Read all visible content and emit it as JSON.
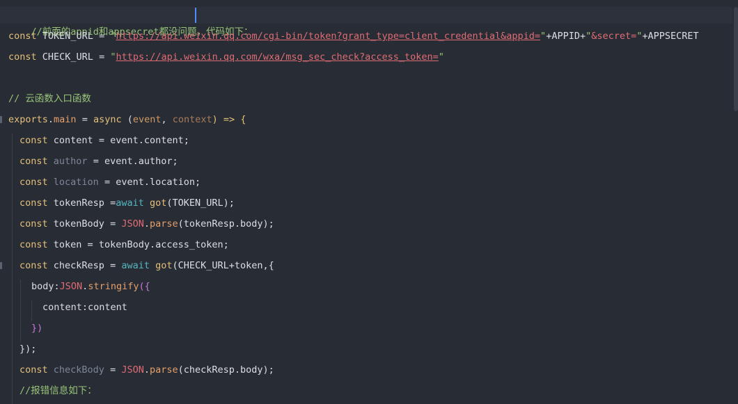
{
  "editor": {
    "lines": [
      {
        "indent": 0,
        "tokens": [
          {
            "t": "//前面的appid和appsecret都没问题，代码如下：",
            "c": "comment"
          }
        ]
      },
      {
        "indent": 0,
        "tokens": [
          {
            "t": "const ",
            "c": "kw2"
          },
          {
            "t": "TOKEN_URL",
            "c": "plain"
          },
          {
            "t": " = ",
            "c": "plain"
          },
          {
            "t": "\"",
            "c": "quote"
          },
          {
            "t": "https://api.weixin.qq.com/cgi-bin/token?grant_type=client_credential&appid=",
            "c": "str"
          },
          {
            "t": "\"",
            "c": "quote"
          },
          {
            "t": "+APPID+",
            "c": "plain"
          },
          {
            "t": "\"",
            "c": "quote"
          },
          {
            "t": "&secret=",
            "c": "str2"
          },
          {
            "t": "\"",
            "c": "quote"
          },
          {
            "t": "+APPSECRET",
            "c": "plain"
          }
        ]
      },
      {
        "indent": 0,
        "tokens": [
          {
            "t": "const ",
            "c": "kw2"
          },
          {
            "t": "CHECK_URL",
            "c": "plain"
          },
          {
            "t": " = ",
            "c": "plain"
          },
          {
            "t": "\"",
            "c": "quote"
          },
          {
            "t": "https://api.weixin.qq.com/wxa/msg_sec_check?access_token=",
            "c": "str"
          },
          {
            "t": "\"",
            "c": "quote"
          }
        ]
      },
      {
        "indent": 0,
        "tokens": []
      },
      {
        "indent": 0,
        "tokens": [
          {
            "t": "// 云函数入口函数",
            "c": "comment"
          }
        ]
      },
      {
        "indent": 0,
        "tokens": [
          {
            "t": "exports",
            "c": "obj"
          },
          {
            "t": ".",
            "c": "plain"
          },
          {
            "t": "main",
            "c": "orange"
          },
          {
            "t": " = ",
            "c": "plain"
          },
          {
            "t": "async",
            "c": "kw2"
          },
          {
            "t": " (",
            "c": "plain"
          },
          {
            "t": "event",
            "c": "param"
          },
          {
            "t": ", ",
            "c": "plain"
          },
          {
            "t": "context",
            "c": "paramdim"
          },
          {
            "t": ") => ",
            "c": "kw2"
          },
          {
            "t": "{",
            "c": "brace"
          }
        ]
      },
      {
        "indent": 1,
        "tokens": [
          {
            "t": "const ",
            "c": "kw2"
          },
          {
            "t": "content",
            "c": "plain"
          },
          {
            "t": " = ",
            "c": "plain"
          },
          {
            "t": "event.content;",
            "c": "plain"
          }
        ]
      },
      {
        "indent": 1,
        "tokens": [
          {
            "t": "const ",
            "c": "kw2"
          },
          {
            "t": "author",
            "c": "dim"
          },
          {
            "t": " = ",
            "c": "plain"
          },
          {
            "t": "event.author;",
            "c": "plain"
          }
        ]
      },
      {
        "indent": 1,
        "tokens": [
          {
            "t": "const ",
            "c": "kw2"
          },
          {
            "t": "location",
            "c": "dim"
          },
          {
            "t": " = ",
            "c": "plain"
          },
          {
            "t": "event.location;",
            "c": "plain"
          }
        ]
      },
      {
        "indent": 1,
        "tokens": [
          {
            "t": "const ",
            "c": "kw2"
          },
          {
            "t": "tokenResp",
            "c": "plain"
          },
          {
            "t": " =",
            "c": "plain"
          },
          {
            "t": "await",
            "c": "await"
          },
          {
            "t": " ",
            "c": "plain"
          },
          {
            "t": "got",
            "c": "fn"
          },
          {
            "t": "(TOKEN_URL);",
            "c": "plain"
          }
        ]
      },
      {
        "indent": 1,
        "tokens": [
          {
            "t": "const ",
            "c": "kw2"
          },
          {
            "t": "tokenBody",
            "c": "plain"
          },
          {
            "t": " = ",
            "c": "plain"
          },
          {
            "t": "JSON",
            "c": "str2"
          },
          {
            "t": ".",
            "c": "plain"
          },
          {
            "t": "parse",
            "c": "orange"
          },
          {
            "t": "(tokenResp.body);",
            "c": "plain"
          }
        ]
      },
      {
        "indent": 1,
        "tokens": [
          {
            "t": "const ",
            "c": "kw2"
          },
          {
            "t": "token",
            "c": "plain"
          },
          {
            "t": " = ",
            "c": "plain"
          },
          {
            "t": "tokenBody.access_token;",
            "c": "plain"
          }
        ]
      },
      {
        "indent": 1,
        "tokens": [
          {
            "t": "const ",
            "c": "kw2"
          },
          {
            "t": "checkResp",
            "c": "plain"
          },
          {
            "t": " = ",
            "c": "plain"
          },
          {
            "t": "await",
            "c": "await"
          },
          {
            "t": " ",
            "c": "plain"
          },
          {
            "t": "got",
            "c": "fn"
          },
          {
            "t": "(CHECK_URL+token,{",
            "c": "plain"
          }
        ]
      },
      {
        "indent": 2,
        "tokens": [
          {
            "t": "body",
            "c": "plain"
          },
          {
            "t": ":",
            "c": "plain"
          },
          {
            "t": "JSON",
            "c": "str2"
          },
          {
            "t": ".",
            "c": "plain"
          },
          {
            "t": "stringify",
            "c": "orange"
          },
          {
            "t": "({",
            "c": "kw"
          }
        ]
      },
      {
        "indent": 3,
        "tokens": [
          {
            "t": "content",
            "c": "plain"
          },
          {
            "t": ":content",
            "c": "plain"
          }
        ]
      },
      {
        "indent": 2,
        "tokens": [
          {
            "t": "})",
            "c": "kw"
          }
        ]
      },
      {
        "indent": 1,
        "tokens": [
          {
            "t": "});",
            "c": "plain"
          }
        ]
      },
      {
        "indent": 1,
        "tokens": [
          {
            "t": "const ",
            "c": "kw2"
          },
          {
            "t": "checkBody",
            "c": "dim"
          },
          {
            "t": " = ",
            "c": "plain"
          },
          {
            "t": "JSON",
            "c": "str2"
          },
          {
            "t": ".",
            "c": "plain"
          },
          {
            "t": "parse",
            "c": "orange"
          },
          {
            "t": "(checkResp.body);",
            "c": "plain"
          }
        ]
      },
      {
        "indent": 1,
        "tokens": [
          {
            "t": "//报错信息如下：",
            "c": "comment"
          }
        ]
      }
    ]
  }
}
